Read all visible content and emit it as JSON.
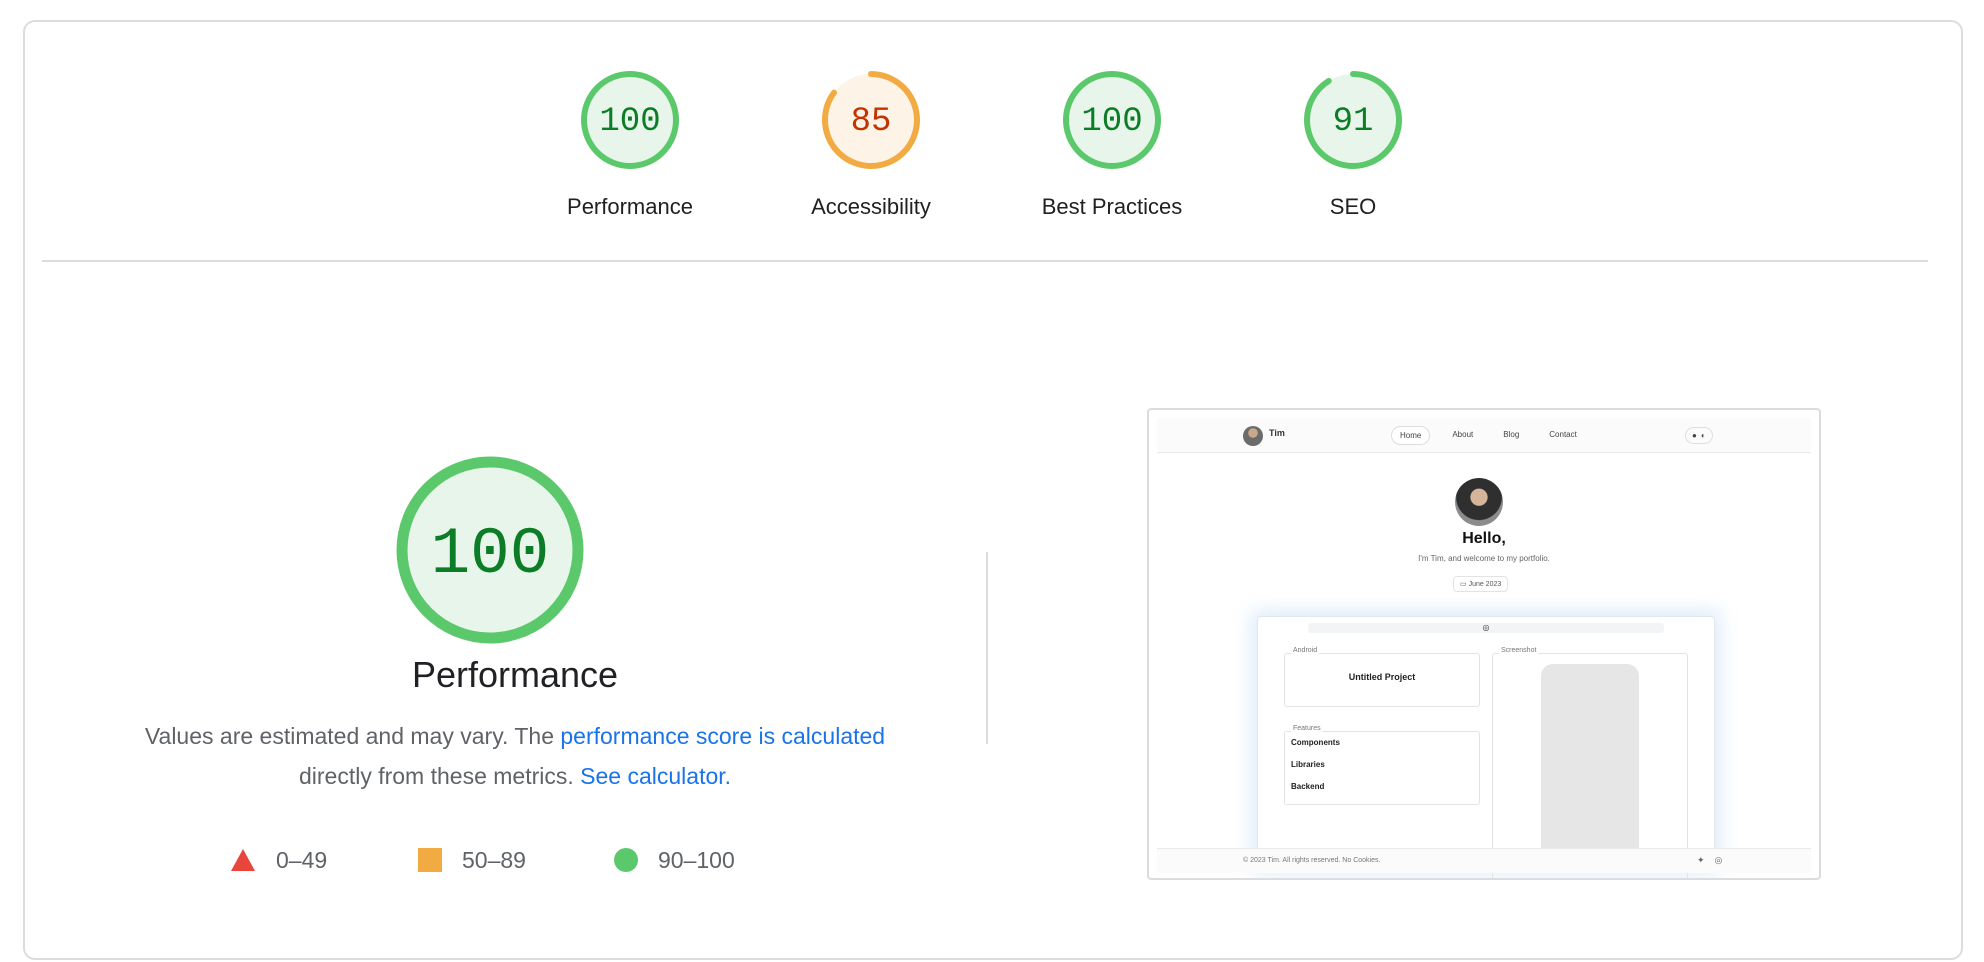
{
  "colors": {
    "pass": "#0c7c26",
    "pass_ring": "#5bc96b",
    "pass_fill": "#e8f5ea",
    "average": "#c33300",
    "average_ring": "#f2aa43",
    "average_fill": "#fdf3e6",
    "fail": "#e8453c",
    "link": "#1a73e8"
  },
  "gauges": [
    {
      "score": 100,
      "label": "Performance",
      "rating": "pass"
    },
    {
      "score": 85,
      "label": "Accessibility",
      "rating": "average"
    },
    {
      "score": 100,
      "label": "Best Practices",
      "rating": "pass"
    },
    {
      "score": 91,
      "label": "SEO",
      "rating": "pass"
    }
  ],
  "performance": {
    "score": 100,
    "title": "Performance",
    "desc_prefix": "Values are estimated and may vary. The ",
    "desc_link": "performance score is calculated",
    "desc_middle": " directly from these metrics. ",
    "calc_link": "See calculator.",
    "legend": [
      {
        "shape": "triangle",
        "range": "0–49"
      },
      {
        "shape": "square",
        "range": "50–89"
      },
      {
        "shape": "circle",
        "range": "90–100"
      }
    ]
  },
  "thumbnail": {
    "name": "Tim",
    "nav": [
      "Home",
      "About",
      "Blog",
      "Contact"
    ],
    "greeting": "Hello,",
    "subtitle": "I'm Tim, and welcome to my portfolio.",
    "date": "June 2023",
    "android_label": "Android",
    "project": "Untitled Project",
    "features_label": "Features",
    "features": [
      "Components",
      "Libraries",
      "Backend"
    ],
    "screenshot_label": "Screenshot",
    "footer": "© 2023 Tim. All rights reserved. No Cookies."
  }
}
